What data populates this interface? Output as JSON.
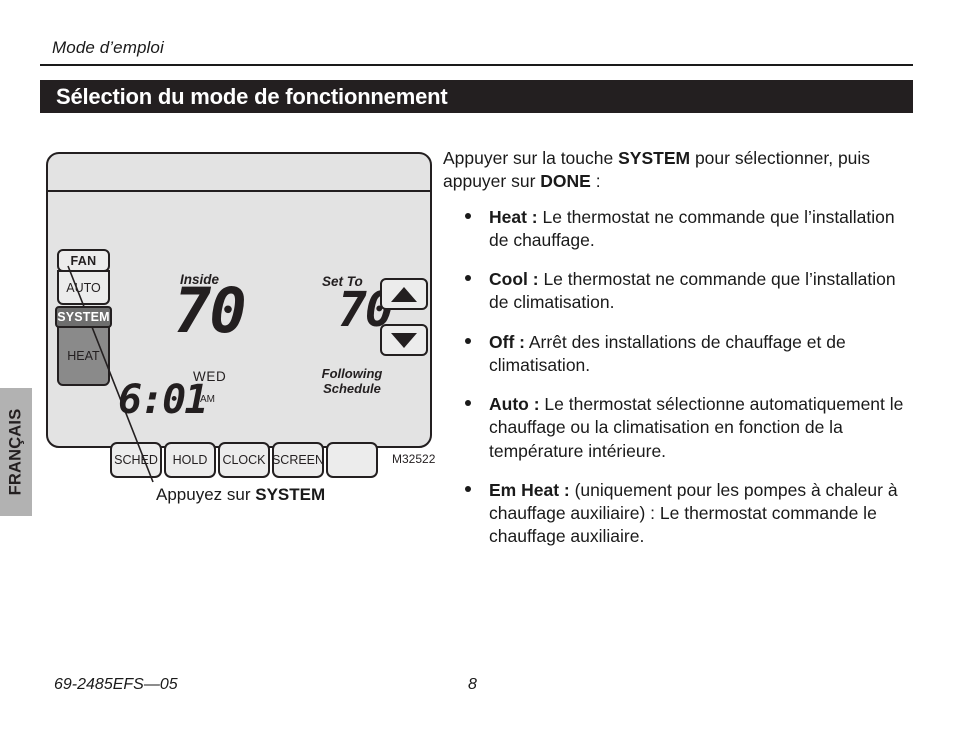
{
  "page": {
    "running_head": "Mode d’emploi",
    "section_title": "Sélection du mode de fonctionnement",
    "side_tab_label": "FRANÇAIS",
    "footer_code": "69-2485EFS—05",
    "footer_page": "8"
  },
  "figure": {
    "code": "M32522",
    "caption_prefix": "Appuyez sur ",
    "caption_bold": "SYSTEM",
    "side_keys": [
      {
        "name": "fan",
        "label": "FAN",
        "state": "normal"
      },
      {
        "name": "auto",
        "label": "AUTO",
        "state": "normal"
      },
      {
        "name": "system",
        "label": "SYSTEM",
        "state": "selected"
      },
      {
        "name": "heat",
        "label": "HEAT",
        "state": "shaded"
      }
    ],
    "soft_keys": [
      {
        "name": "sched",
        "label": "SCHED"
      },
      {
        "name": "hold",
        "label": "HOLD"
      },
      {
        "name": "clock",
        "label": "CLOCK"
      },
      {
        "name": "screen",
        "label": "SCREEN"
      },
      {
        "name": "blank",
        "label": ""
      }
    ],
    "arrow_keys": [
      {
        "name": "up",
        "glyph": "triangle-up-icon"
      },
      {
        "name": "down",
        "glyph": "triangle-down-icon"
      }
    ],
    "lcd": {
      "inside_caption": "Inside",
      "inside_temp": "70",
      "setto_caption": "Set To",
      "setto_temp": "70",
      "day": "WED",
      "time": "6:01",
      "meridiem": "AM",
      "status_line1": "Following",
      "status_line2": "Schedule"
    }
  },
  "content": {
    "intro_part1": "Appuyer sur la touche ",
    "intro_bold1": "SYSTEM",
    "intro_part2": " pour sélectionner, puis appuyer sur ",
    "intro_bold2": "DONE",
    "intro_part3": " :",
    "bullets": [
      {
        "term": "Heat :",
        "text": " Le thermostat ne commande que l’installation de chauffage."
      },
      {
        "term": "Cool :",
        "text": " Le thermostat ne commande que l’installation de climatisation."
      },
      {
        "term": "Off :",
        "text": " Arrêt des installations de chauffage et de climatisation."
      },
      {
        "term": "Auto :",
        "text": " Le thermostat sélectionne automatiquement le chauffage ou la climatisation en fonction de la température intérieure."
      },
      {
        "term": "Em Heat :",
        "text": " (uniquement pour les pompes à chaleur à chauffage auxiliaire) : Le thermostat commande le chauffage auxiliaire."
      }
    ]
  },
  "colors": {
    "ink": "#231f20",
    "bar_bg": "#231f20",
    "bar_text": "#ffffff",
    "tab_bg": "#b2b2b2",
    "device_bg": "#e3e3e3",
    "key_bg": "#ececec",
    "selected_key_bg": "#6e6e6e",
    "shaded_key_bg": "#8a8a8a"
  }
}
